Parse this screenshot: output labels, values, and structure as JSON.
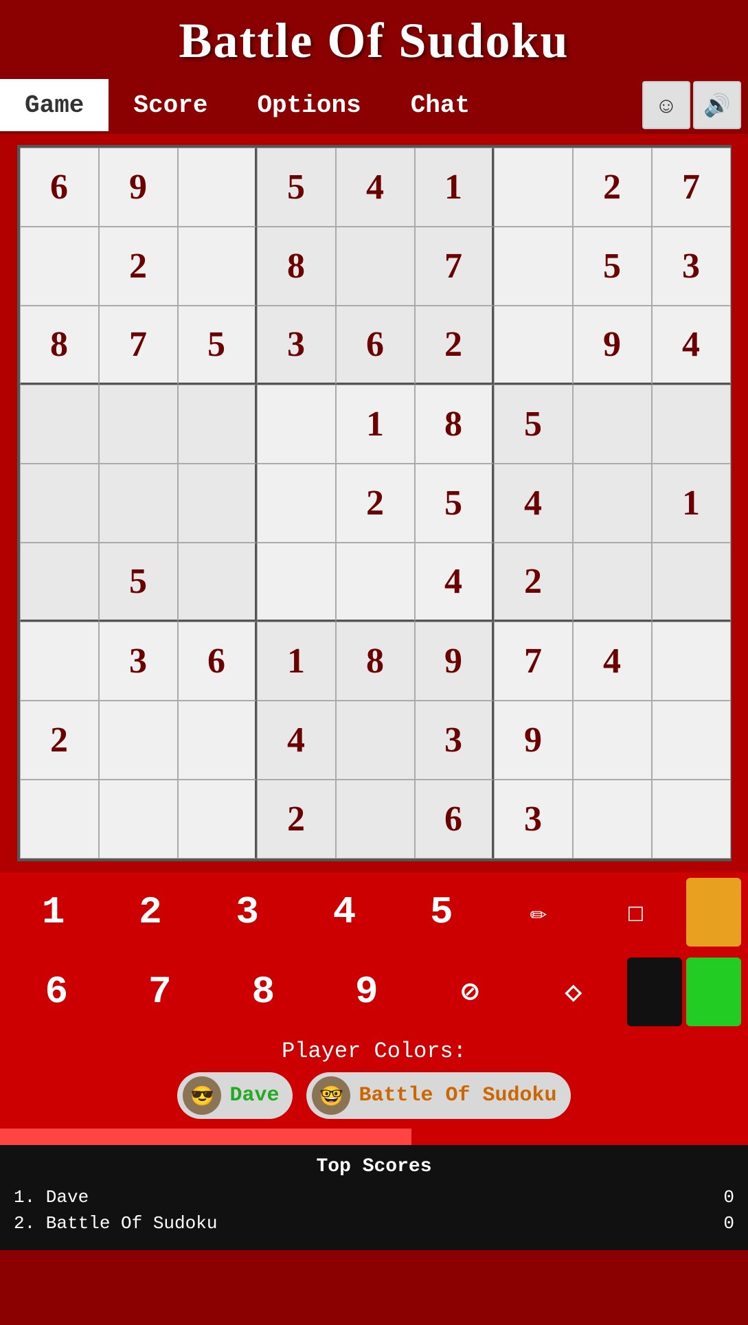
{
  "header": {
    "title": "Battle Of Sudoku"
  },
  "nav": {
    "tabs": [
      {
        "label": "Game",
        "active": true
      },
      {
        "label": "Score",
        "active": false
      },
      {
        "label": "Options",
        "active": false
      },
      {
        "label": "Chat",
        "active": false
      }
    ],
    "emoji_icon": "☺",
    "sound_icon": "🔊"
  },
  "grid": {
    "cells": [
      [
        "6",
        "9",
        "",
        "5",
        "4",
        "1",
        "",
        "2",
        "7"
      ],
      [
        "",
        "2",
        "",
        "8",
        "",
        "7",
        "",
        "5",
        "3"
      ],
      [
        "8",
        "7",
        "5",
        "3",
        "6",
        "2",
        "",
        "9",
        "4"
      ],
      [
        "",
        "",
        "",
        "",
        "1",
        "8",
        "5",
        "",
        ""
      ],
      [
        "",
        "",
        "",
        "",
        "2",
        "5",
        "4",
        "",
        "1"
      ],
      [
        "",
        "5",
        "",
        "",
        "",
        "4",
        "2",
        "",
        ""
      ],
      [
        "",
        "3",
        "6",
        "1",
        "8",
        "9",
        "7",
        "4",
        ""
      ],
      [
        "2",
        "",
        "",
        "4",
        "",
        "3",
        "9",
        "",
        ""
      ],
      [
        "",
        "",
        "",
        "2",
        "",
        "6",
        "3",
        "",
        ""
      ]
    ]
  },
  "numpad": {
    "row1": [
      "1",
      "2",
      "3",
      "4",
      "5"
    ],
    "row1_icons": [
      "pencil",
      "square"
    ],
    "row1_swatch": "orange",
    "row2": [
      "6",
      "7",
      "8",
      "9"
    ],
    "row2_icons": [
      "no",
      "fill"
    ],
    "row2_swatch1": "black",
    "row2_swatch2": "green"
  },
  "player_colors": {
    "label": "Player Colors:",
    "players": [
      {
        "name": "Dave",
        "color": "green",
        "avatar": "😎"
      },
      {
        "name": "Battle Of Sudoku",
        "color": "orange",
        "avatar": "🤓"
      }
    ]
  },
  "top_scores": {
    "title": "Top Scores",
    "entries": [
      {
        "rank": "1.",
        "name": "Dave",
        "score": "0"
      },
      {
        "rank": "2.",
        "name": "Battle Of Sudoku",
        "score": "0"
      }
    ]
  }
}
